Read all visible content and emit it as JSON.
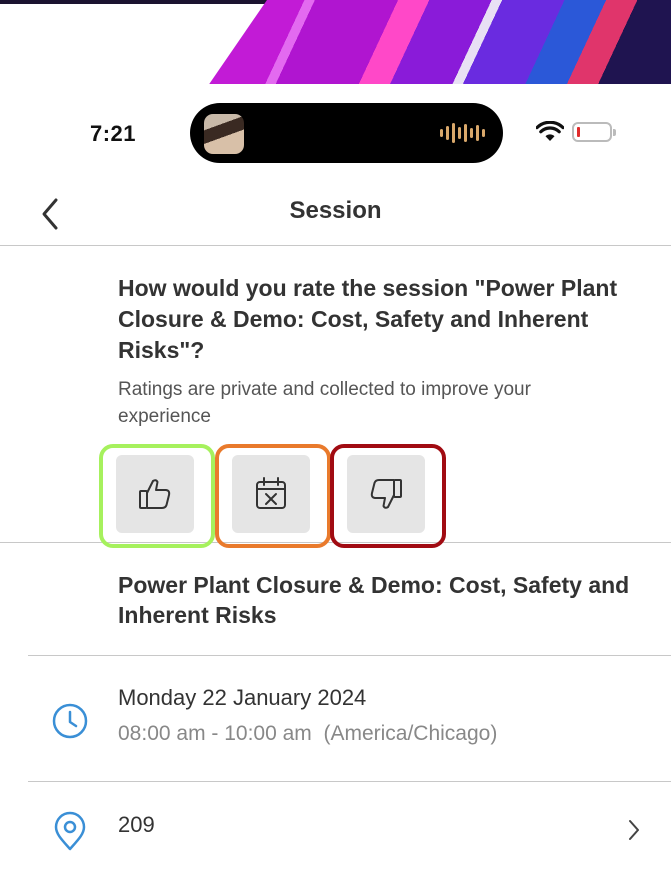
{
  "status": {
    "time": "7:21",
    "icons": [
      "wifi-icon",
      "battery-low-icon"
    ]
  },
  "nav": {
    "title": "Session",
    "back_icon": "chevron-left-icon"
  },
  "rating": {
    "question": "How would you rate the session \"Power Plant Closure & Demo: Cost, Safety and Inherent Risks\"?",
    "note": "Ratings are private and collected to improve your experience",
    "buttons": [
      {
        "icon": "thumbs-up-icon",
        "outline_color": "#a6f15d"
      },
      {
        "icon": "calendar-x-icon",
        "outline_color": "#e97a2c"
      },
      {
        "icon": "thumbs-down-icon",
        "outline_color": "#a10b12"
      }
    ]
  },
  "session": {
    "title": "Power Plant Closure & Demo: Cost, Safety and Inherent Risks",
    "date": "Monday 22 January 2024",
    "time_range": "08:00 am - 10:00 am",
    "timezone": "(America/Chicago)",
    "room": "209"
  },
  "colors": {
    "icon_blue": "#3a8fd6",
    "text": "#333333",
    "muted": "#888888",
    "button_bg": "#e5e5e5"
  }
}
